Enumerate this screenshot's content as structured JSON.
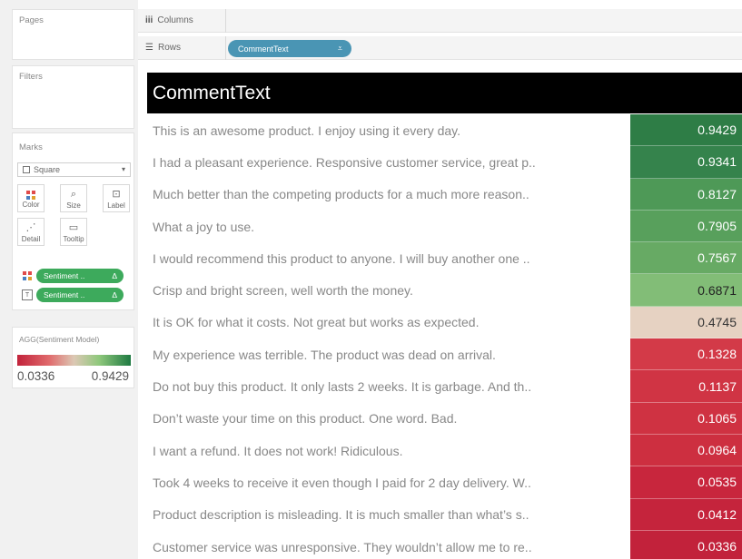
{
  "cards": {
    "pages": "Pages",
    "filters": "Filters",
    "marks": "Marks",
    "legend": "AGG(Sentiment Model)"
  },
  "marks": {
    "mark_type": "Square",
    "buttons": [
      "Color",
      "Size",
      "Label",
      "Detail",
      "Tooltip"
    ],
    "pills": [
      {
        "label": "Sentiment ..",
        "delta": "Δ",
        "icon": "color-dots-icon"
      },
      {
        "label": "Sentiment ..",
        "delta": "Δ",
        "icon": "label-t-icon"
      }
    ]
  },
  "legend": {
    "min": "0.0336",
    "max": "0.9429",
    "colors": {
      "low": "#c2233b",
      "mid": "#dcc8b4",
      "high": "#1f7a42"
    }
  },
  "shelves": {
    "columns_label": "Columns",
    "rows_label": "Rows",
    "rows_pill": "CommentText",
    "rows_pill_icon": "sort-icon"
  },
  "viz": {
    "header": "CommentText",
    "rows": [
      {
        "text": "This is an awesome product. I enjoy using it every day.",
        "value": "0.9429",
        "color": "#2e7d46",
        "text_color": "#ffffff"
      },
      {
        "text": "I had a pleasant experience. Responsive customer service, great p..",
        "value": "0.9341",
        "color": "#35834c",
        "text_color": "#ffffff"
      },
      {
        "text": "Much better than the competing products for a much more reason..",
        "value": "0.8127",
        "color": "#4e9957",
        "text_color": "#ffffff"
      },
      {
        "text": "What a joy to use.",
        "value": "0.7905",
        "color": "#58a05c",
        "text_color": "#ffffff"
      },
      {
        "text": "I would recommend this product to anyone. I will buy another one ..",
        "value": "0.7567",
        "color": "#67aa64",
        "text_color": "#ffffff"
      },
      {
        "text": "Crisp and bright screen, well worth the money.",
        "value": "0.6871",
        "color": "#82bd77",
        "text_color": "#222222"
      },
      {
        "text": "It is OK for what it costs. Not great but works as expected.",
        "value": "0.4745",
        "color": "#e6d2c2",
        "text_color": "#333333"
      },
      {
        "text": "My experience was terrible. The product was dead on arrival.",
        "value": "0.1328",
        "color": "#d33a48",
        "text_color": "#ffffff"
      },
      {
        "text": "Do not buy this product. It only lasts 2 weeks. It is garbage. And th..",
        "value": "0.1137",
        "color": "#d03444",
        "text_color": "#ffffff"
      },
      {
        "text": "Don’t waste your time on this product. One word. Bad.",
        "value": "0.1065",
        "color": "#cf3242",
        "text_color": "#ffffff"
      },
      {
        "text": "I want a refund. It does not work! Ridiculous.",
        "value": "0.0964",
        "color": "#cd2f40",
        "text_color": "#ffffff"
      },
      {
        "text": "Took 4 weeks to receive it even though I paid for 2 day delivery. W..",
        "value": "0.0535",
        "color": "#c8263d",
        "text_color": "#ffffff"
      },
      {
        "text": "Product description is misleading. It is much smaller than what’s s..",
        "value": "0.0412",
        "color": "#c5243c",
        "text_color": "#ffffff"
      },
      {
        "text": "Customer service was unresponsive. They wouldn’t allow me to re..",
        "value": "0.0336",
        "color": "#c2223b",
        "text_color": "#ffffff"
      }
    ]
  }
}
